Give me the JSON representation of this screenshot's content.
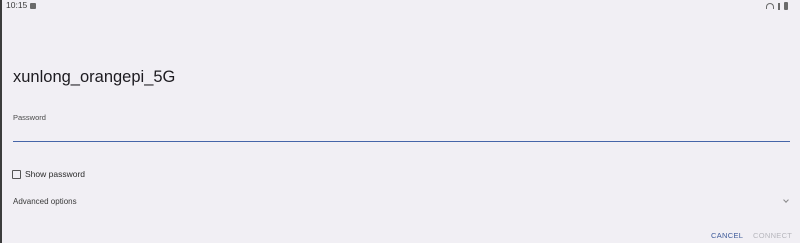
{
  "status_bar": {
    "time": "10:15",
    "icons": [
      "notification-icon",
      "headset-icon",
      "bluetooth-icon",
      "battery-icon"
    ]
  },
  "dialog": {
    "title": "xunlong_orangepi_5G",
    "password": {
      "label": "Password",
      "value": "",
      "placeholder": ""
    },
    "show_password": {
      "label": "Show password",
      "checked": false
    },
    "advanced_options": {
      "label": "Advanced options",
      "icon": "chevron-down-icon"
    },
    "buttons": {
      "cancel": "CANCEL",
      "connect": "CONNECT"
    }
  },
  "colors": {
    "background": "#f1eff4",
    "accent": "#3d5a99",
    "underline": "#4665a8",
    "disabled": "#b7b7bd"
  }
}
